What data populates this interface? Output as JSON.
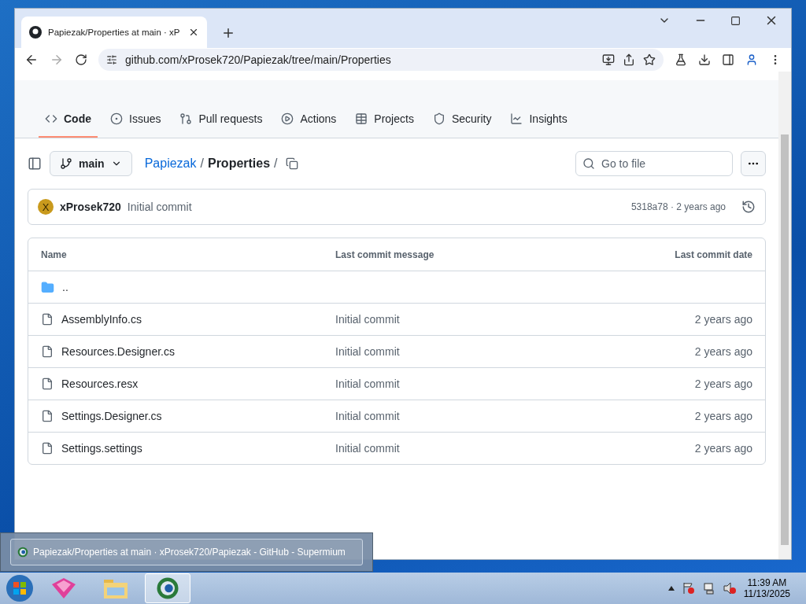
{
  "browser": {
    "tab_title": "Papiezak/Properties at main · xP",
    "url": "github.com/xProsek720/Papiezak/tree/main/Properties"
  },
  "repo_nav": [
    {
      "label": "Code",
      "selected": true
    },
    {
      "label": "Issues",
      "selected": false
    },
    {
      "label": "Pull requests",
      "selected": false
    },
    {
      "label": "Actions",
      "selected": false
    },
    {
      "label": "Projects",
      "selected": false
    },
    {
      "label": "Security",
      "selected": false
    },
    {
      "label": "Insights",
      "selected": false
    }
  ],
  "file_toolbar": {
    "branch": "main",
    "breadcrumb_link": "Papiezak",
    "breadcrumb_current": "Properties",
    "separator": "/",
    "search_placeholder": "Go to file"
  },
  "latest_commit": {
    "avatar_letter": "X",
    "author": "xProsek720",
    "message": "Initial commit",
    "hash_time": "5318a78 · 2 years ago"
  },
  "file_table": {
    "columns": [
      "Name",
      "Last commit message",
      "Last commit date"
    ],
    "rows": [
      {
        "kind": "folder",
        "name": "..",
        "message": "",
        "date": ""
      },
      {
        "kind": "file",
        "name": "AssemblyInfo.cs",
        "message": "Initial commit",
        "date": "2 years ago"
      },
      {
        "kind": "file",
        "name": "Resources.Designer.cs",
        "message": "Initial commit",
        "date": "2 years ago"
      },
      {
        "kind": "file",
        "name": "Resources.resx",
        "message": "Initial commit",
        "date": "2 years ago"
      },
      {
        "kind": "file",
        "name": "Settings.Designer.cs",
        "message": "Initial commit",
        "date": "2 years ago"
      },
      {
        "kind": "file",
        "name": "Settings.settings",
        "message": "Initial commit",
        "date": "2 years ago"
      }
    ]
  },
  "taskbar_preview": {
    "title": "Papiezak/Properties at main · xProsek720/Papiezak - GitHub - Supermium"
  },
  "taskbar": {
    "apps": [
      {
        "kind": "cube",
        "selected": false
      },
      {
        "kind": "folder",
        "selected": false
      },
      {
        "kind": "browser",
        "selected": true
      }
    ],
    "time": "11:39 AM",
    "date": "11/13/2025"
  }
}
